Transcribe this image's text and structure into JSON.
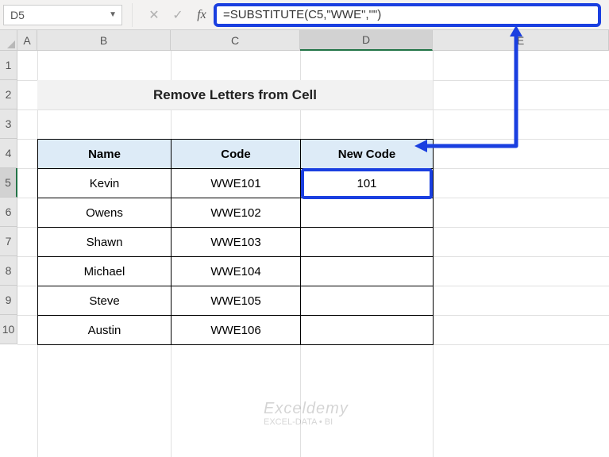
{
  "formula_bar": {
    "cell_ref": "D5",
    "formula": "=SUBSTITUTE(C5,\"WWE\",\"\")",
    "fx_label": "fx",
    "cancel_icon": "✕",
    "confirm_icon": "✓"
  },
  "columns": [
    "A",
    "B",
    "C",
    "D",
    "E"
  ],
  "rows": [
    "1",
    "2",
    "3",
    "4",
    "5",
    "6",
    "7",
    "8",
    "9",
    "10"
  ],
  "active_column": "D",
  "active_row": "5",
  "title": "Remove Letters from Cell",
  "table": {
    "headers": {
      "name": "Name",
      "code": "Code",
      "new_code": "New Code"
    },
    "rows": [
      {
        "name": "Kevin",
        "code": "WWE101",
        "new_code": "101"
      },
      {
        "name": "Owens",
        "code": "WWE102",
        "new_code": ""
      },
      {
        "name": "Shawn",
        "code": "WWE103",
        "new_code": ""
      },
      {
        "name": "Michael",
        "code": "WWE104",
        "new_code": ""
      },
      {
        "name": "Steve",
        "code": "WWE105",
        "new_code": ""
      },
      {
        "name": "Austin",
        "code": "WWE106",
        "new_code": ""
      }
    ]
  },
  "watermark": {
    "brand": "Exceldemy",
    "tagline": "EXCEL-DATA • BI"
  },
  "chart_data": {
    "type": "table",
    "title": "Remove Letters from Cell",
    "columns": [
      "Name",
      "Code",
      "New Code"
    ],
    "rows": [
      [
        "Kevin",
        "WWE101",
        "101"
      ],
      [
        "Owens",
        "WWE102",
        ""
      ],
      [
        "Shawn",
        "WWE103",
        ""
      ],
      [
        "Michael",
        "WWE104",
        ""
      ],
      [
        "Steve",
        "WWE105",
        ""
      ],
      [
        "Austin",
        "WWE106",
        ""
      ]
    ],
    "formula_for_D5": "=SUBSTITUTE(C5,\"WWE\",\"\")"
  }
}
